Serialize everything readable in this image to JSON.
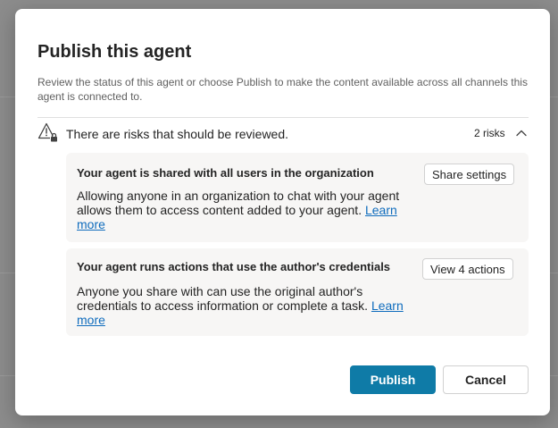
{
  "dialog": {
    "title": "Publish this agent",
    "description": "Review the status of this agent or choose Publish to make the content available across all channels this agent is connected to."
  },
  "risks": {
    "summary": "There are risks that should be reviewed.",
    "count_label": "2 risks",
    "warning_icon": "warning-lock-icon",
    "collapse_icon": "chevron-up-icon",
    "items": [
      {
        "title": "Your agent is shared with all users in the organization",
        "body": "Allowing anyone in an organization to chat with your agent allows them to access content added to your agent.",
        "link": "Learn more",
        "action": "Share settings"
      },
      {
        "title": "Your agent runs actions that use the author's credentials",
        "body": "Anyone you share with can use the original author's credentials to access information or complete a task.",
        "link": "Learn more",
        "action": "View 4 actions"
      }
    ]
  },
  "footer": {
    "publish_label": "Publish",
    "cancel_label": "Cancel"
  },
  "colors": {
    "primary": "#0f7ba7",
    "link": "#0f6cbd",
    "card_background": "#f7f6f5"
  }
}
